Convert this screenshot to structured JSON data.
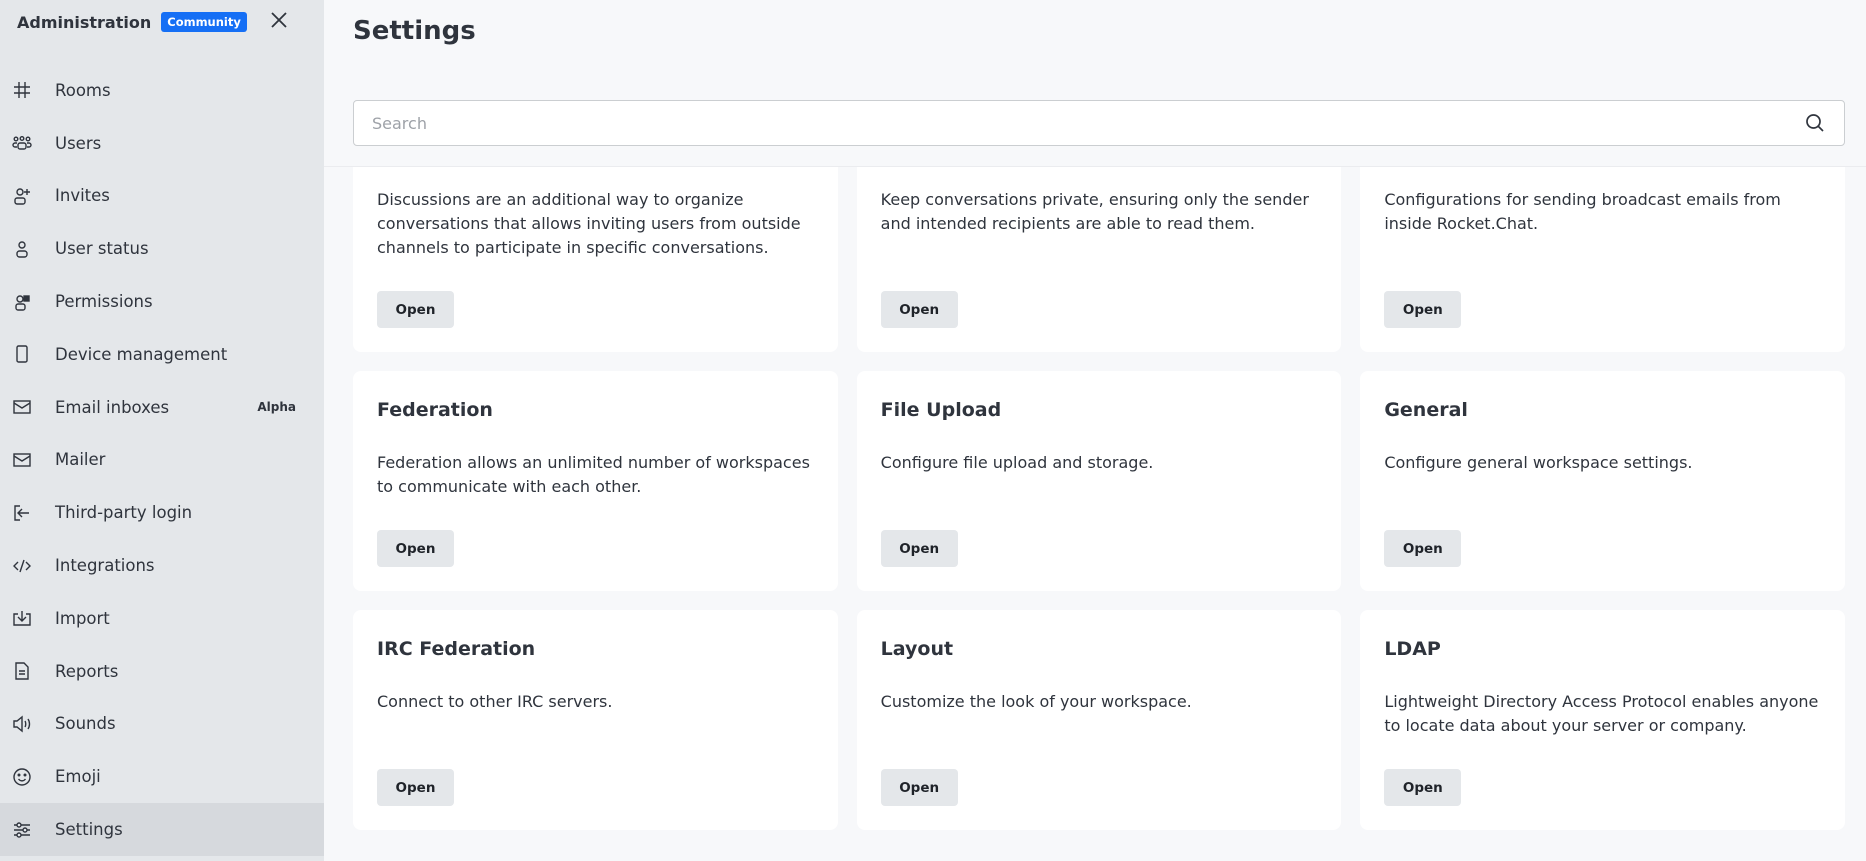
{
  "sidebar": {
    "title": "Administration",
    "edition_badge": "Community",
    "close_icon": "close-icon",
    "items": [
      {
        "label": "Rooms",
        "icon": "hash-icon"
      },
      {
        "label": "Users",
        "icon": "team-icon"
      },
      {
        "label": "Invites",
        "icon": "user-plus-icon"
      },
      {
        "label": "User status",
        "icon": "user-icon"
      },
      {
        "label": "Permissions",
        "icon": "user-lock-icon"
      },
      {
        "label": "Device management",
        "icon": "mobile-icon"
      },
      {
        "label": "Email inboxes",
        "icon": "mail-icon",
        "tag": "Alpha"
      },
      {
        "label": "Mailer",
        "icon": "mail-icon"
      },
      {
        "label": "Third-party login",
        "icon": "login-icon"
      },
      {
        "label": "Integrations",
        "icon": "code-icon"
      },
      {
        "label": "Import",
        "icon": "download-icon"
      },
      {
        "label": "Reports",
        "icon": "document-icon"
      },
      {
        "label": "Sounds",
        "icon": "speaker-icon"
      },
      {
        "label": "Emoji",
        "icon": "emoji-icon"
      },
      {
        "label": "Settings",
        "icon": "sliders-icon",
        "active": true
      }
    ]
  },
  "header": {
    "title": "Settings",
    "search_placeholder": "Search",
    "search_value": ""
  },
  "cards": [
    {
      "title": "",
      "description": "Discussions are an additional way to organize conversations that allows inviting users from outside channels to participate in specific conversations.",
      "button": "Open"
    },
    {
      "title": "",
      "description": "Keep conversations private, ensuring only the sender and intended recipients are able to read them.",
      "button": "Open"
    },
    {
      "title": "",
      "description": "Configurations for sending broadcast emails from inside Rocket.Chat.",
      "button": "Open"
    },
    {
      "title": "Federation",
      "description": "Federation allows an unlimited number of workspaces to communicate with each other.",
      "button": "Open"
    },
    {
      "title": "File Upload",
      "description": "Configure file upload and storage.",
      "button": "Open"
    },
    {
      "title": "General",
      "description": "Configure general workspace settings.",
      "button": "Open"
    },
    {
      "title": "IRC Federation",
      "description": "Connect to other IRC servers.",
      "button": "Open"
    },
    {
      "title": "Layout",
      "description": "Customize the look of your workspace.",
      "button": "Open"
    },
    {
      "title": "LDAP",
      "description": "Lightweight Directory Access Protocol enables anyone to locate data about your server or company.",
      "button": "Open"
    }
  ],
  "colors": {
    "sidebar_bg": "#e4e7ea",
    "active_item": "#d6d9dd",
    "badge": "#156ff5",
    "button_bg": "#e4e7ea"
  }
}
